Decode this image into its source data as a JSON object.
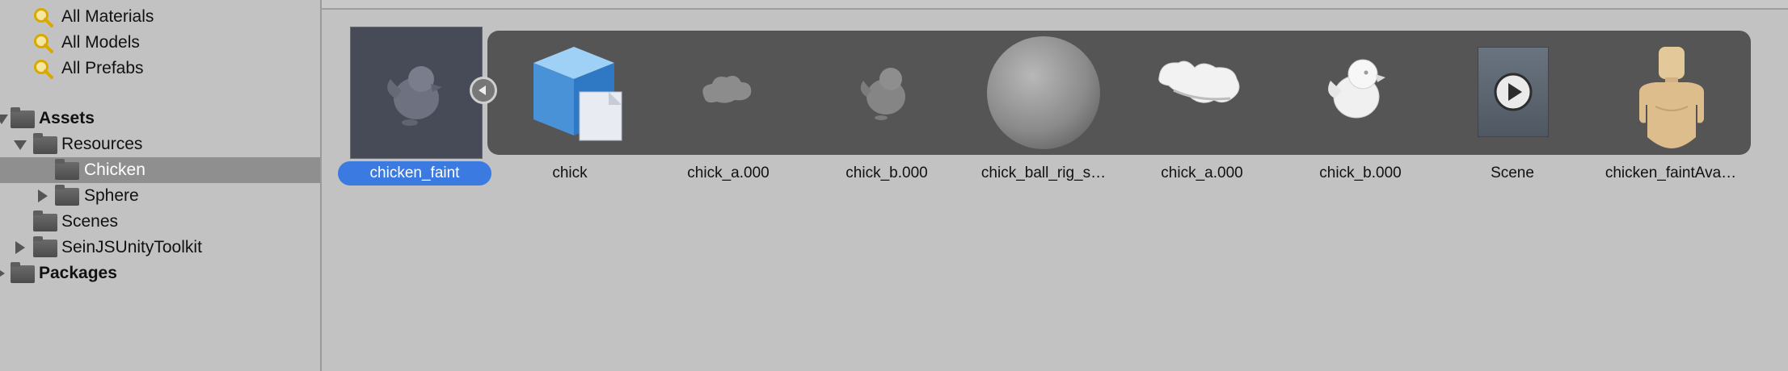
{
  "tree": {
    "items": [
      {
        "label": "All Materials"
      },
      {
        "label": "All Models"
      },
      {
        "label": "All Prefabs"
      },
      {
        "label": "Assets"
      },
      {
        "label": "Resources"
      },
      {
        "label": "Chicken"
      },
      {
        "label": "Sphere"
      },
      {
        "label": "Scenes"
      },
      {
        "label": "SeinJSUnityToolkit"
      },
      {
        "label": "Packages"
      }
    ]
  },
  "assets": {
    "items": [
      {
        "label": "chicken_faint",
        "icon": "chicken-prefab-icon",
        "selected": true
      },
      {
        "label": "chick",
        "icon": "prefab-cube-icon"
      },
      {
        "label": "chick_a.000",
        "icon": "mesh-wing-icon"
      },
      {
        "label": "chick_b.000",
        "icon": "mesh-chick-icon"
      },
      {
        "label": "chick_ball_rig_s…",
        "icon": "sphere-icon"
      },
      {
        "label": "chick_a.000",
        "icon": "mesh-wing-white-icon"
      },
      {
        "label": "chick_b.000",
        "icon": "mesh-chick-white-icon"
      },
      {
        "label": "Scene",
        "icon": "scene-play-icon"
      },
      {
        "label": "chicken_faintAva…",
        "icon": "avatar-mannequin-icon"
      }
    ]
  },
  "colors": {
    "selection": "#3b7ae0",
    "strip": "#555555",
    "panel": "#c2c2c2"
  }
}
